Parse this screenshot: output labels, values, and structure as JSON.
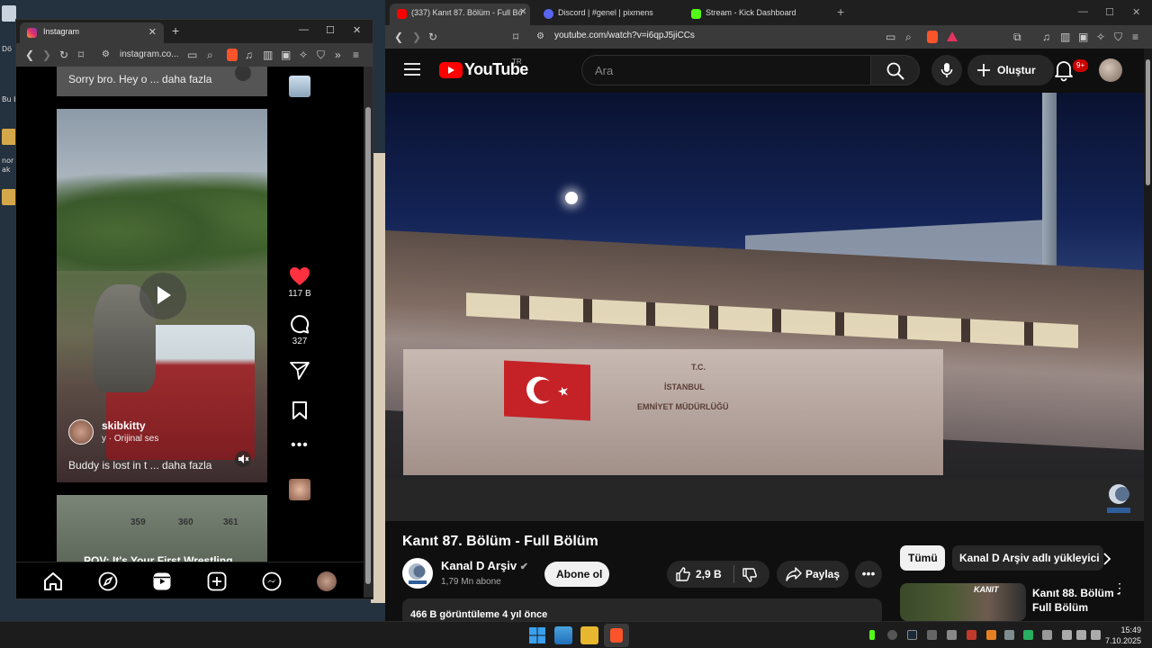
{
  "desktop": {
    "labels": [
      "Dö",
      "Bu b",
      "nor",
      "ak"
    ]
  },
  "instagram_window": {
    "tab_title": "Instagram",
    "url": "instagram.co...",
    "reels": [
      {
        "caption": "Sorry bro. Hey o ... daha fazla"
      },
      {
        "username": "skibkitty",
        "audio": "y · Orijinal ses",
        "caption": "Buddy is lost in t ... daha fazla",
        "likes": "117 B",
        "comments": "327"
      },
      {
        "numbers": [
          "359",
          "360",
          "361"
        ],
        "caption": "POV: It's Your First Wrestling"
      }
    ],
    "bottom_nav": [
      "home-icon",
      "explore-icon",
      "reels-icon",
      "create-icon",
      "messenger-icon",
      "profile-avatar"
    ]
  },
  "browser": {
    "tabs": [
      {
        "title": "(337) Kanıt 87. Bölüm - Full Bö",
        "active": true,
        "favicon_color": "#ff0000"
      },
      {
        "title": "Discord | #genel | pixmens",
        "active": false,
        "favicon_color": "#5865f2"
      },
      {
        "title": "Stream - Kick Dashboard",
        "active": false,
        "favicon_color": "#53fc18"
      }
    ],
    "url": "youtube.com/watch?v=i6qpJ5jiCCs"
  },
  "youtube": {
    "logo": "YouTube",
    "country": "TR",
    "search_placeholder": "Ara",
    "create_label": "Oluştur",
    "notifications_badge": "9+",
    "video": {
      "title": "Kanıt 87. Bölüm - Full Bölüm",
      "channel": "Kanal D Arşiv",
      "subscribers": "1,79 Mn abone",
      "subscribe_label": "Abone ol",
      "likes": "2,9 B",
      "share_label": "Paylaş",
      "views_date": "466 B görüntüleme  4 yıl önce",
      "overlay_text": [
        "T.C.",
        "İSTANBUL",
        "EMNİYET MÜDÜRLÜĞÜ"
      ]
    },
    "chips": [
      "Tümü",
      "Kanal D Arşiv adlı yükleyici"
    ],
    "recommendation": {
      "title": "Kanıt 88. Bölüm - Full Bölüm",
      "thumb_label": "KANIT"
    }
  },
  "taskbar": {
    "time": "15:49",
    "date": "7.10.2025"
  },
  "colors": {
    "youtube_red": "#ff0000",
    "instagram_like": "#ff3040",
    "brave_orange": "#fb542b"
  }
}
